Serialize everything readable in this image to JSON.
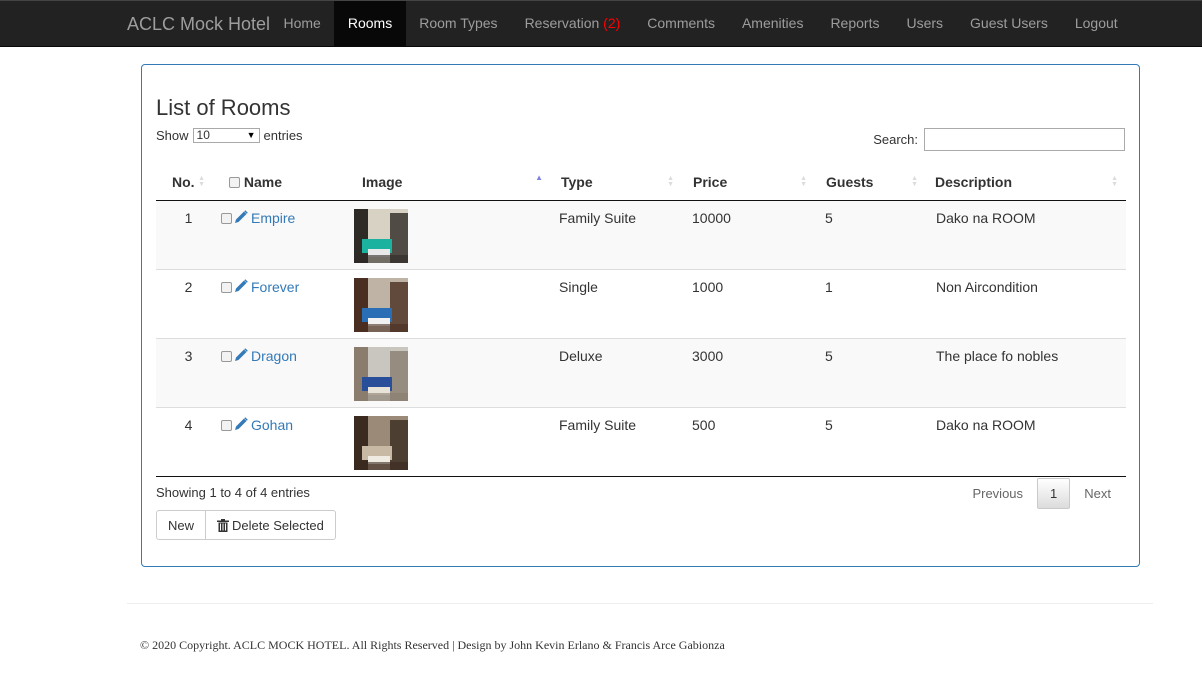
{
  "navbar": {
    "brand": "ACLC Mock Hotel",
    "items": [
      {
        "label": "Home",
        "active": false
      },
      {
        "label": "Rooms",
        "active": true
      },
      {
        "label": "Room Types",
        "active": false
      },
      {
        "label": "Reservation",
        "badge": "(2)",
        "active": false
      },
      {
        "label": "Comments",
        "active": false
      },
      {
        "label": "Amenities",
        "active": false
      },
      {
        "label": "Reports",
        "active": false
      },
      {
        "label": "Users",
        "active": false
      },
      {
        "label": "Guest Users",
        "active": false
      },
      {
        "label": "Logout",
        "active": false
      }
    ]
  },
  "page": {
    "title": "List of Rooms",
    "length": {
      "show_label": "Show",
      "value": "10",
      "entries_label": "entries"
    },
    "search": {
      "label": "Search:",
      "value": "",
      "placeholder": ""
    }
  },
  "table": {
    "columns": [
      "No.",
      "Name",
      "Image",
      "Type",
      "Price",
      "Guests",
      "Description"
    ],
    "rows": [
      {
        "no": "1",
        "name": "Empire",
        "image": "room-photo-teal-suite",
        "type": "Family Suite",
        "price": "10000",
        "guests": "5",
        "description": "Dako na ROOM"
      },
      {
        "no": "2",
        "name": "Forever",
        "image": "room-photo-blue-bed",
        "type": "Single",
        "price": "1000",
        "guests": "1",
        "description": "Non Aircondition"
      },
      {
        "no": "3",
        "name": "Dragon",
        "image": "room-photo-blue-chairs",
        "type": "Deluxe",
        "price": "3000",
        "guests": "5",
        "description": "The place fo nobles"
      },
      {
        "no": "4",
        "name": "Gohan",
        "image": "room-photo-wood-bedroom",
        "type": "Family Suite",
        "price": "500",
        "guests": "5",
        "description": "Dako na ROOM"
      }
    ]
  },
  "footer_table": {
    "info": "Showing 1 to 4 of 4 entries",
    "previous": "Previous",
    "current_page": "1",
    "next": "Next"
  },
  "actions": {
    "new": "New",
    "delete_selected": "Delete Selected"
  },
  "footer": {
    "text": "© 2020 Copyright. ACLC MOCK HOTEL. All Rights Reserved | Design by John Kevin Erlano & Francis Arce Gabionza"
  },
  "colors": {
    "navbar_bg": "#222222",
    "active_nav_bg": "#080808",
    "link": "#337ab7",
    "panel_border": "#337ab7",
    "badge": "#ff0000"
  }
}
